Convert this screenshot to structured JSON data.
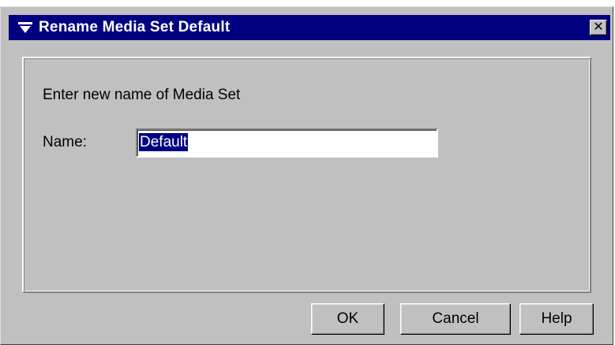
{
  "window": {
    "title": "Rename Media Set Default",
    "menu_icon": "down-triangle-menu-icon",
    "close_icon": "close-x-icon",
    "close_glyph": "✕"
  },
  "form": {
    "prompt": "Enter new name of Media Set",
    "name_label": "Name:",
    "name_value": "Default",
    "name_selected": true
  },
  "buttons": {
    "ok": "OK",
    "cancel": "Cancel",
    "help": "Help"
  },
  "colors": {
    "titlebar": "#000080",
    "dialog_bg": "#c0c0c0",
    "selection": "#000080"
  }
}
